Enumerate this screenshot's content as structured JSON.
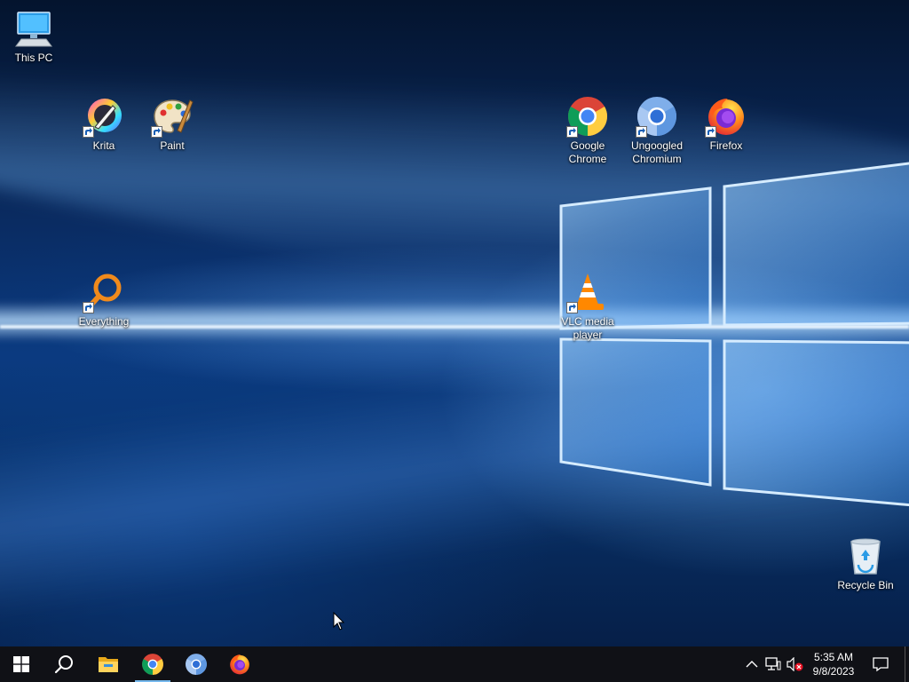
{
  "desktop": {
    "icons": [
      {
        "id": "this-pc",
        "label": "This PC"
      },
      {
        "id": "krita",
        "label": "Krita"
      },
      {
        "id": "paint",
        "label": "Paint"
      },
      {
        "id": "chrome",
        "label": "Google Chrome"
      },
      {
        "id": "ungoogled",
        "label": "Ungoogled Chromium"
      },
      {
        "id": "firefox",
        "label": "Firefox"
      },
      {
        "id": "everything",
        "label": "Everything"
      },
      {
        "id": "vlc",
        "label": "VLC media player"
      },
      {
        "id": "recycle",
        "label": "Recycle Bin"
      }
    ]
  },
  "taskbar": {
    "pinned": [
      "start-icon",
      "search-icon",
      "file-explorer-icon",
      "chrome-icon",
      "chromium-icon",
      "firefox-icon"
    ],
    "active_app": "Google Chrome",
    "accent": "#76b9ed",
    "background": "#101116"
  },
  "tray": {
    "time": "5:35 AM",
    "date": "9/8/2023",
    "icons": [
      "chevron-up-icon",
      "network-icon",
      "volume-muted-icon",
      "notifications-icon"
    ]
  }
}
